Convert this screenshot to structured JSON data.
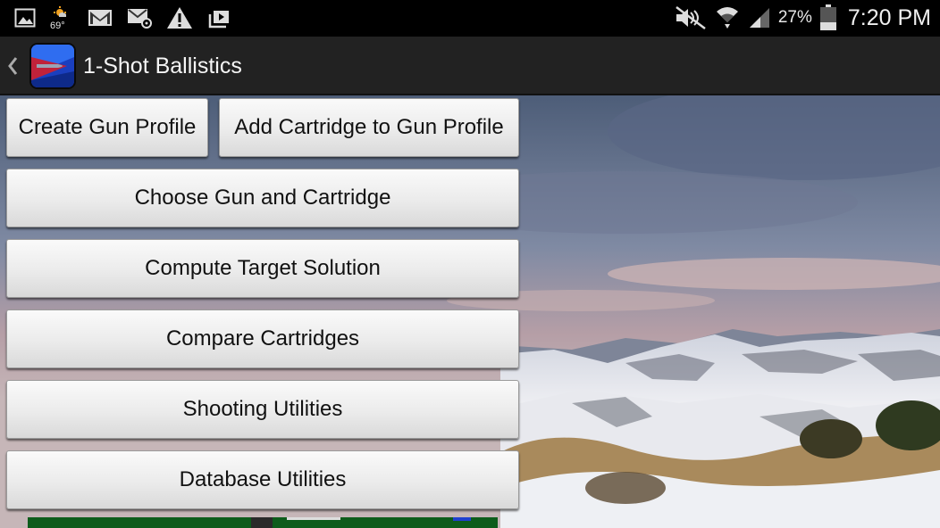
{
  "status_bar": {
    "weather_temp": "69°",
    "battery_percent": "27%",
    "time": "7:20 PM",
    "icons": [
      "gallery-icon",
      "weather-icon",
      "gmail-icon",
      "email-icon",
      "warning-icon",
      "media-icon",
      "mute-icon",
      "wifi-icon",
      "signal-icon",
      "battery-icon"
    ]
  },
  "action_bar": {
    "title": "1-Shot Ballistics"
  },
  "menu": {
    "create_gun_profile": "Create Gun Profile",
    "add_cartridge": "Add Cartridge to Gun Profile",
    "choose_gun_cartridge": "Choose Gun and Cartridge",
    "compute_target_solution": "Compute Target Solution",
    "compare_cartridges": "Compare Cartridges",
    "shooting_utilities": "Shooting Utilities",
    "database_utilities": "Database Utilities"
  }
}
